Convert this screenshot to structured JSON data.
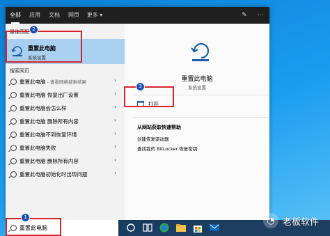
{
  "tabs": [
    "全部",
    "应用",
    "文档",
    "网页",
    "更多 ▾"
  ],
  "left_panel": {
    "best_match_label": "最佳匹配",
    "best_match": {
      "title": "重置此电脑",
      "subtitle": "系统设置"
    },
    "web_label": "搜索网页",
    "web_results": [
      {
        "text": "重置此电脑",
        "sub": " - 查看网络搜索结果"
      },
      {
        "text": "重置此电脑 恢复出厂设置",
        "sub": ""
      },
      {
        "text": "重置此电脑会怎么样",
        "sub": ""
      },
      {
        "text": "重置此电脑 删除所有内容",
        "sub": ""
      },
      {
        "text": "重置此电脑不到恢复环境",
        "sub": ""
      },
      {
        "text": "重置此电脑失败",
        "sub": ""
      },
      {
        "text": "重置此电脑 删除所有内容",
        "sub": ""
      },
      {
        "text": "重置此电脑初始化时出现问题",
        "sub": ""
      }
    ]
  },
  "right_panel": {
    "title": "重置此电脑",
    "subtitle": "系统设置",
    "open_label": "打开",
    "help_title": "从网站获取快速帮助",
    "help_links": [
      "创建恢复驱动器",
      "查找我的 BitLocker 恢复密钥"
    ]
  },
  "search": {
    "value": "重置此电脑"
  },
  "watermark": {
    "text": "老板软件"
  },
  "badges": [
    "1",
    "2",
    "3"
  ],
  "colors": {
    "accent": "#0078d7",
    "highlight": "#a9d0f0",
    "annotation": "#d9252a"
  }
}
